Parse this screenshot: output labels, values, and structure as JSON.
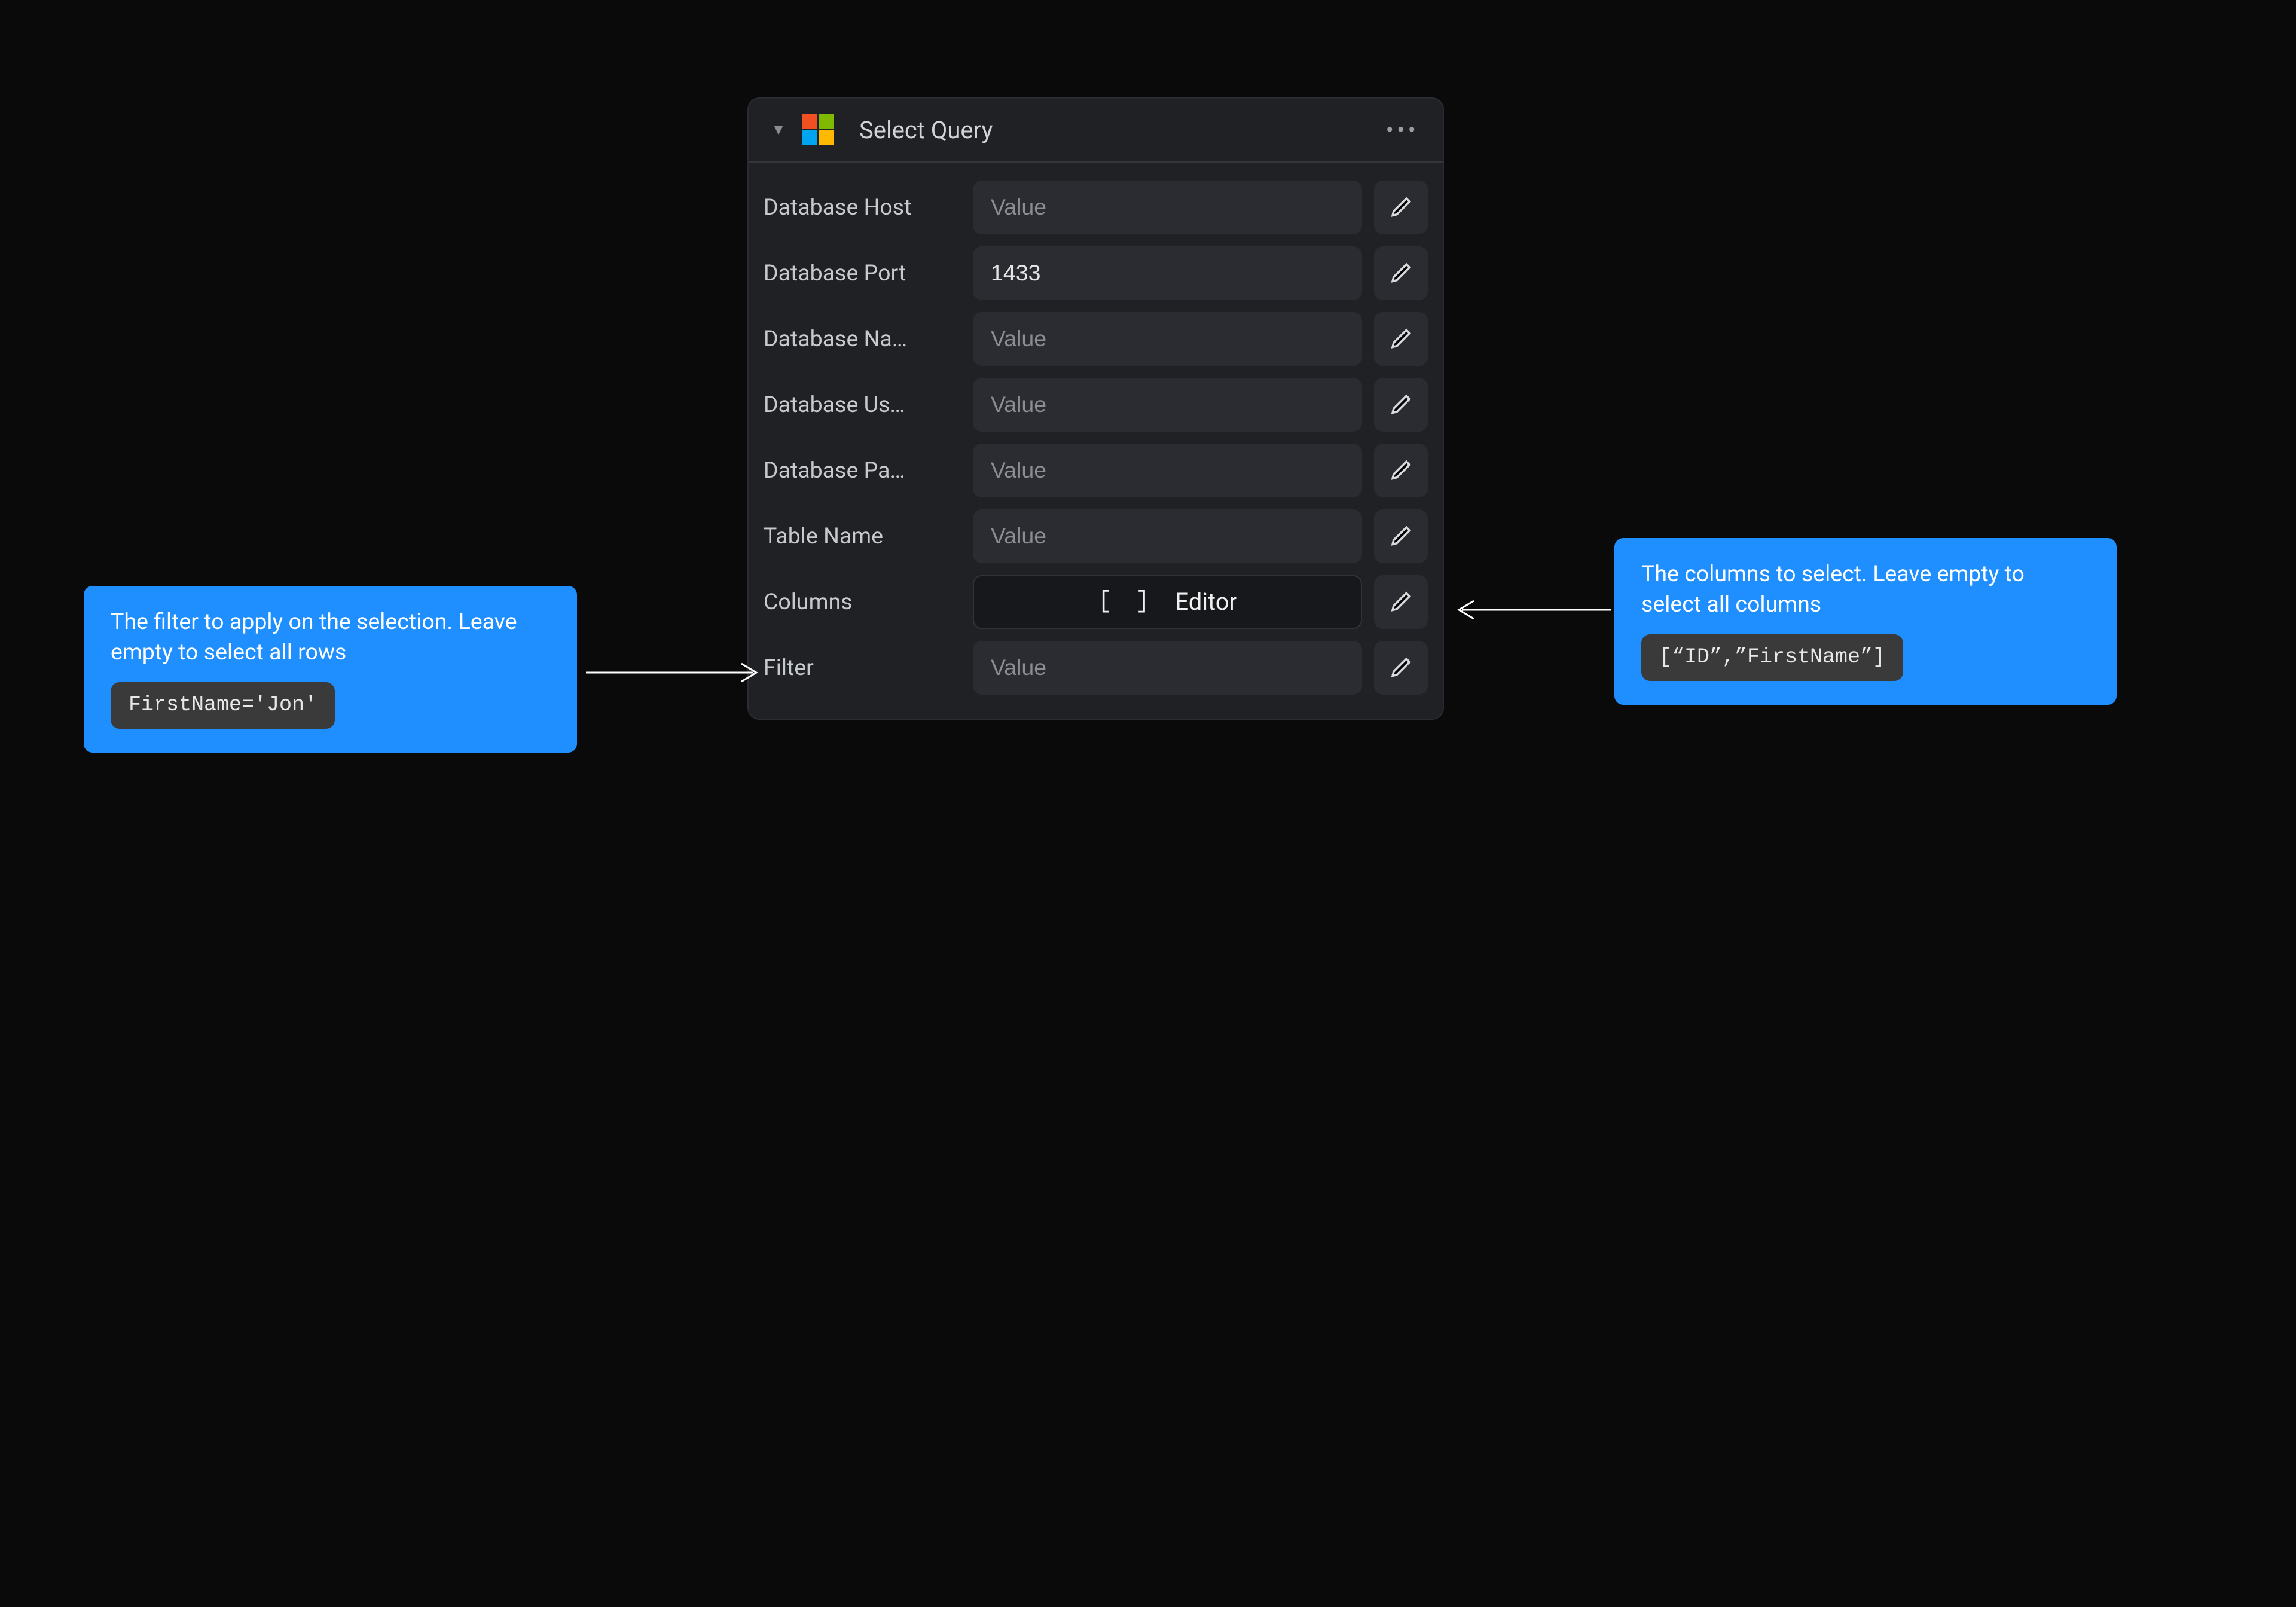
{
  "panel": {
    "title": "Select Query",
    "fields": {
      "db_host": {
        "label": "Database Host",
        "placeholder": "Value",
        "value": ""
      },
      "db_port": {
        "label": "Database Port",
        "placeholder": "Value",
        "value": "1433"
      },
      "db_name": {
        "label": "Database Na…",
        "placeholder": "Value",
        "value": ""
      },
      "db_user": {
        "label": "Database Us…",
        "placeholder": "Value",
        "value": ""
      },
      "db_pass": {
        "label": "Database Pa…",
        "placeholder": "Value",
        "value": ""
      },
      "table": {
        "label": "Table Name",
        "placeholder": "Value",
        "value": ""
      },
      "columns": {
        "label": "Columns",
        "editor_prefix": "[ ]",
        "editor_label": "Editor"
      },
      "filter": {
        "label": "Filter",
        "placeholder": "Value",
        "value": ""
      }
    }
  },
  "callouts": {
    "filter": {
      "text": "The filter to apply on the selection. Leave empty to select all rows",
      "example": "FirstName='Jon'"
    },
    "columns": {
      "text": "The columns to select. Leave empty to select all columns",
      "example": "[“ID”,”FirstName”]"
    }
  }
}
